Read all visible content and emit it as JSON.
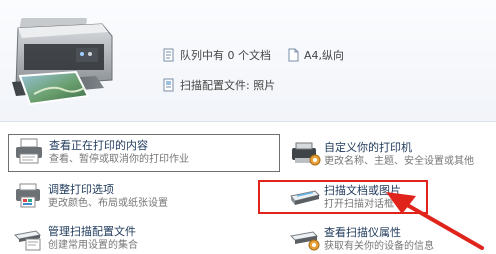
{
  "header": {
    "printer_name": "",
    "queue_status": "队列中有 0 个文档",
    "paper_size": "A4,纵向",
    "scan_profile": "扫描配置文件: 照片"
  },
  "tasks": [
    {
      "title": "查看正在打印的内容",
      "desc": "查看、暂停或取消你的打印作业",
      "icon": "printer-queue-icon"
    },
    {
      "title": "自定义你的打印机",
      "desc": "更改名称、主题、安全设置或其他",
      "icon": "printer-settings-icon"
    },
    {
      "title": "调整打印选项",
      "desc": "更改颜色、布局或纸张设置",
      "icon": "print-options-icon"
    },
    {
      "title": "扫描文档或图片",
      "desc": "打开扫描对话框",
      "icon": "scanner-icon"
    },
    {
      "title": "管理扫描配置文件",
      "desc": "创建常用设置的集合",
      "icon": "scan-profile-icon"
    },
    {
      "title": "查看扫描仪属性",
      "desc": "获取有关你的设备的信息",
      "icon": "scanner-properties-icon"
    }
  ],
  "colors": {
    "highlight": "#e0241c",
    "link": "#1e395b"
  }
}
